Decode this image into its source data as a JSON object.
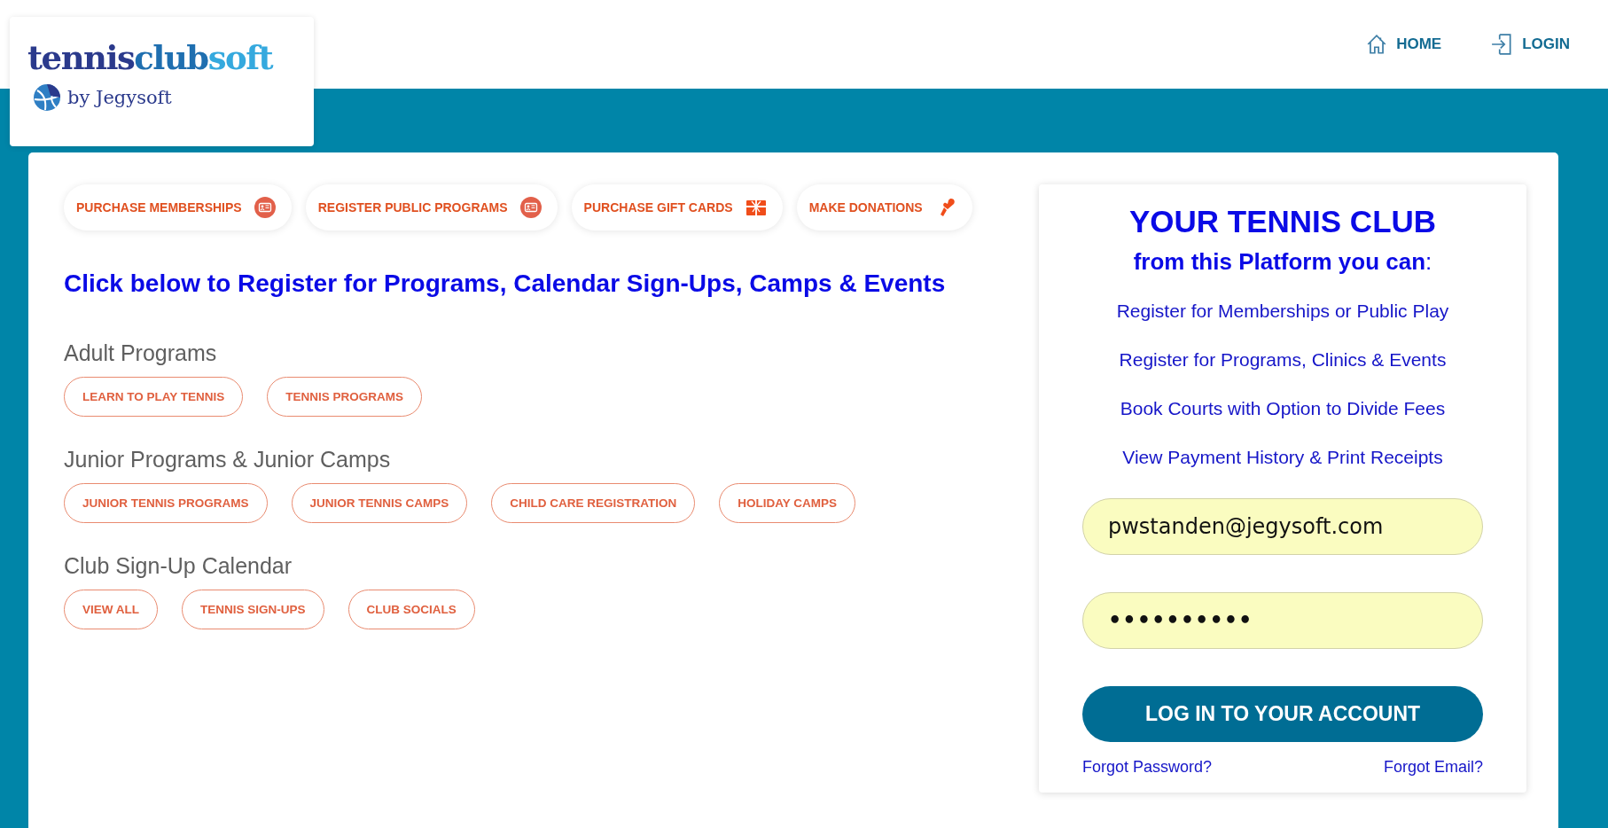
{
  "logo": {
    "wordmark": [
      "tennis",
      "club",
      "soft"
    ],
    "byline": "by Jegysoft"
  },
  "nav": [
    {
      "label": "HOME",
      "kind": "home"
    },
    {
      "label": "LOGIN",
      "kind": "login"
    }
  ],
  "quick_actions": [
    {
      "label": "PURCHASE MEMBERSHIPS",
      "kind": "card"
    },
    {
      "label": "REGISTER PUBLIC PROGRAMS",
      "kind": "card"
    },
    {
      "label": "PURCHASE GIFT CARDS",
      "kind": "gift"
    },
    {
      "label": "MAKE DONATIONS",
      "kind": "donate"
    }
  ],
  "heading": "Click below to Register for Programs, Calendar Sign-Ups, Camps & Events",
  "sections": [
    {
      "title": "Adult Programs",
      "buttons": [
        "LEARN TO PLAY TENNIS",
        "TENNIS PROGRAMS"
      ]
    },
    {
      "title": "Junior Programs & Junior Camps",
      "buttons": [
        "JUNIOR TENNIS PROGRAMS",
        "JUNIOR TENNIS CAMPS",
        "CHILD CARE REGISTRATION",
        "HOLIDAY CAMPS"
      ]
    },
    {
      "title": "Club Sign-Up Calendar",
      "buttons": [
        "VIEW ALL",
        "TENNIS SIGN-UPS",
        "CLUB SOCIALS"
      ]
    }
  ],
  "login_panel": {
    "title": "YOUR TENNIS CLUB",
    "subtitle": "**from this Platform you can**:",
    "features": [
      "Register for Memberships or Public Play",
      "Register for Programs, Clinics & Events",
      "Book Courts with Option to Divide Fees",
      "View Payment History & Print Receipts"
    ],
    "email": {
      "value": "pwstanden@jegysoft.com"
    },
    "password": {
      "value": "••••••••••"
    },
    "submit": "LOG IN TO YOUR ACCOUNT",
    "links": [
      "Forgot Password?",
      "Forgot Email?"
    ]
  }
}
